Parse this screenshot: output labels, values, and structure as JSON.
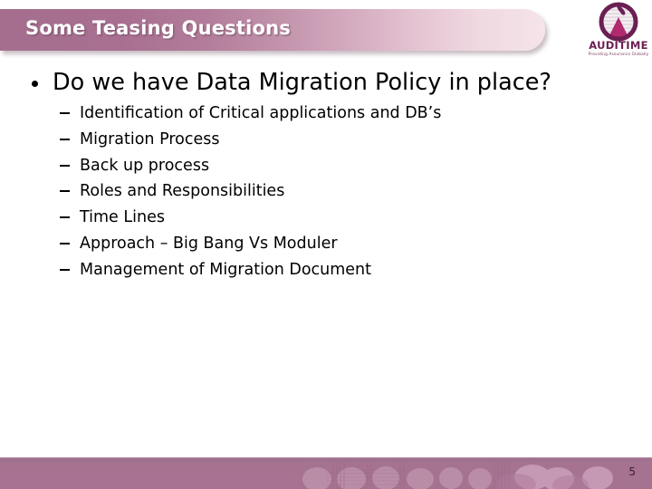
{
  "slide": {
    "title": "Some Teasing Questions",
    "page_number": "5",
    "colors": {
      "banner_start": "#a56e8e",
      "banner_end": "#f5e4e9",
      "footer": "#a5728f",
      "logo_purple": "#6b1f52",
      "logo_magenta": "#b02a6e",
      "text": "#000000"
    }
  },
  "logo": {
    "wordmark_audi": "AUD",
    "wordmark_i": "I",
    "wordmark_time": "TIME",
    "wordmark_full": "AUDITIME",
    "tagline": "Providing Assurance Globally",
    "mark": "circle-mountain-logo-icon"
  },
  "content": {
    "main_bullet": "Do we have Data Migration Policy in place?",
    "sub_bullets": [
      "Identification of Critical applications and DB’s",
      "Migration Process",
      "Back up process",
      "Roles and Responsibilities",
      "Time Lines",
      "Approach – Big Bang Vs Moduler",
      "Management of Migration Document"
    ]
  }
}
